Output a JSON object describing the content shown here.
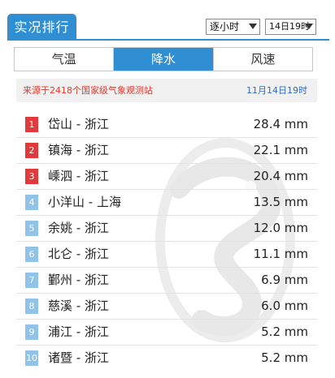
{
  "header": {
    "title": "实况排行",
    "period_select": "逐小时",
    "date_select": "14日19时"
  },
  "tabs": [
    {
      "label": "气温",
      "active": false
    },
    {
      "label": "降水",
      "active": true
    },
    {
      "label": "风速",
      "active": false
    }
  ],
  "info": {
    "source": "来源于2418个国家级气象观测站",
    "time": "11月14日19时"
  },
  "ranking": [
    {
      "rank": "1",
      "station": "岱山 - 浙江",
      "value": "28.4 mm",
      "highlight": true
    },
    {
      "rank": "2",
      "station": "镇海 - 浙江",
      "value": "22.1 mm",
      "highlight": true
    },
    {
      "rank": "3",
      "station": "嵊泗 - 浙江",
      "value": "20.4 mm",
      "highlight": true
    },
    {
      "rank": "4",
      "station": "小洋山 - 上海",
      "value": "13.5 mm",
      "highlight": false
    },
    {
      "rank": "5",
      "station": "余姚 - 浙江",
      "value": "12.0 mm",
      "highlight": false
    },
    {
      "rank": "6",
      "station": "北仑 - 浙江",
      "value": "11.1 mm",
      "highlight": false
    },
    {
      "rank": "7",
      "station": "鄞州 - 浙江",
      "value": "6.9 mm",
      "highlight": false
    },
    {
      "rank": "8",
      "station": "慈溪 - 浙江",
      "value": "6.0 mm",
      "highlight": false
    },
    {
      "rank": "9",
      "station": "浦江 - 浙江",
      "value": "5.2 mm",
      "highlight": false
    },
    {
      "rank": "10",
      "station": "诸暨 - 浙江",
      "value": "5.2 mm",
      "highlight": false
    }
  ],
  "colors": {
    "accent": "#2f8fd2",
    "top_rank": "#e23a3a",
    "other_rank": "#8fc3ea",
    "source_text": "#e23a2e",
    "time_text": "#2f6fc0"
  },
  "icons": {
    "watermark": "dragon-logo-icon",
    "dropdown": "chevron-down-icon"
  }
}
